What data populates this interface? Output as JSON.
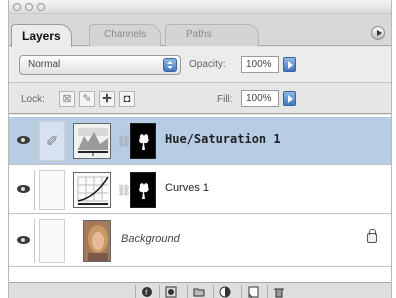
{
  "window": {
    "title": ""
  },
  "tabs": [
    {
      "label": "Layers",
      "active": true
    },
    {
      "label": "Channels",
      "active": false
    },
    {
      "label": "Paths",
      "active": false
    }
  ],
  "options": {
    "blend_mode": "Normal",
    "opacity_label": "Opacity:",
    "opacity_value": "100%",
    "lock_label": "Lock:",
    "fill_label": "Fill:",
    "fill_value": "100%"
  },
  "layers": [
    {
      "name": "Hue/Saturation 1",
      "type": "adjustment",
      "visible": true,
      "selected": true,
      "thumbnail": "hue-saturation-icon"
    },
    {
      "name": "Curves 1",
      "type": "adjustment",
      "visible": true,
      "selected": false,
      "thumbnail": "curves-icon"
    },
    {
      "name": "Background",
      "type": "image",
      "visible": true,
      "selected": false,
      "locked": true,
      "thumbnail": "portrait-photo"
    }
  ],
  "bottom_buttons": [
    "link-layers-icon",
    "add-layer-style-icon",
    "add-mask-icon",
    "new-fill-adjustment-icon",
    "new-set-icon",
    "new-layer-icon",
    "trash-icon"
  ],
  "colors": {
    "selection": "#b7cde6",
    "accent": "#3f78c4"
  }
}
